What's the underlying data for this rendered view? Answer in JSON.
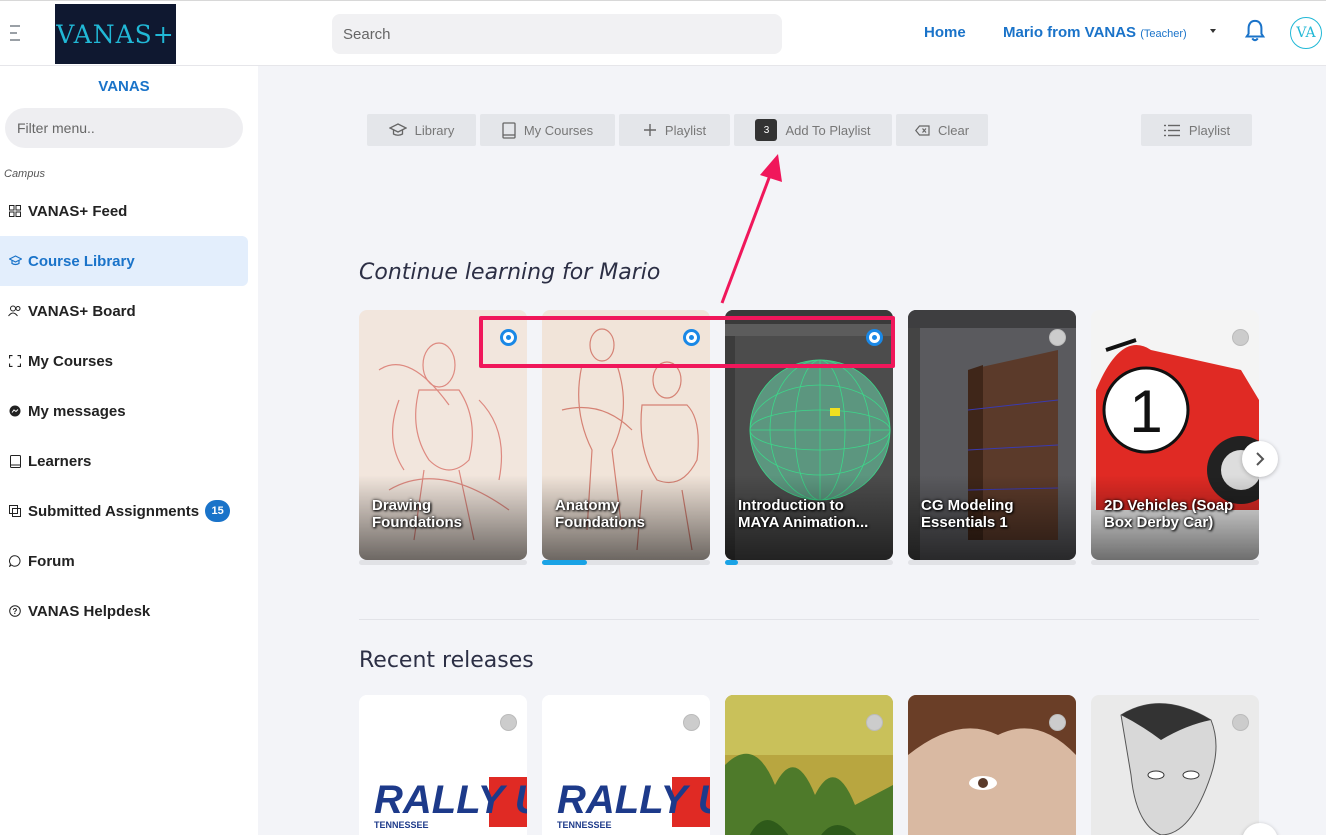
{
  "header": {
    "logo_text": "VANAS+",
    "search_placeholder": "Search",
    "home_label": "Home",
    "user_name": "Mario from VANAS",
    "user_role": "(Teacher)",
    "avatar_text": "VA"
  },
  "sidebar": {
    "title": "VANAS",
    "filter_placeholder": "Filter menu..",
    "section_label": "Campus",
    "items": [
      {
        "label": "VANAS+ Feed",
        "icon": "grid-icon"
      },
      {
        "label": "Course Library",
        "icon": "graduation-cap-icon",
        "active": true
      },
      {
        "label": "VANAS+ Board",
        "icon": "people-icon"
      },
      {
        "label": "My Courses",
        "icon": "frame-icon"
      },
      {
        "label": "My messages",
        "icon": "messenger-icon"
      },
      {
        "label": "Learners",
        "icon": "book-icon"
      },
      {
        "label": "Submitted Assignments",
        "icon": "assignment-icon",
        "badge": "15"
      },
      {
        "label": "Forum",
        "icon": "chat-bubble-icon"
      },
      {
        "label": "VANAS Helpdesk",
        "icon": "help-icon"
      }
    ]
  },
  "toolbar": {
    "library": "Library",
    "my_courses": "My Courses",
    "playlist_add": "Playlist",
    "add_count": "3",
    "add_to_playlist": "Add To Playlist",
    "clear": "Clear",
    "playlist": "Playlist"
  },
  "continue": {
    "title": "Continue learning for Mario",
    "cards": [
      {
        "title": "Drawing Foundations",
        "selected": true,
        "progress": 0
      },
      {
        "title": "Anatomy Foundations",
        "selected": true,
        "progress": 0.27
      },
      {
        "title": "Introduction to MAYA Animation...",
        "selected": true,
        "progress": 0.08
      },
      {
        "title": "CG Modeling Essentials 1",
        "selected": false,
        "progress": 0
      },
      {
        "title": "2D Vehicles (Soap Box Derby Car)",
        "selected": false,
        "progress": 0
      }
    ]
  },
  "recent": {
    "title": "Recent releases",
    "cards": [
      {
        "image_text": "RALLY US",
        "sub_text": "TENNESSEE"
      },
      {
        "image_text": "RALLY US",
        "sub_text": "TENNESSEE"
      },
      {
        "image_text": ""
      },
      {
        "image_text": ""
      },
      {
        "image_text": ""
      }
    ]
  },
  "colors": {
    "accent": "#1a73c9",
    "annotation": "#f0175b",
    "progress": "#1aa3e6"
  }
}
